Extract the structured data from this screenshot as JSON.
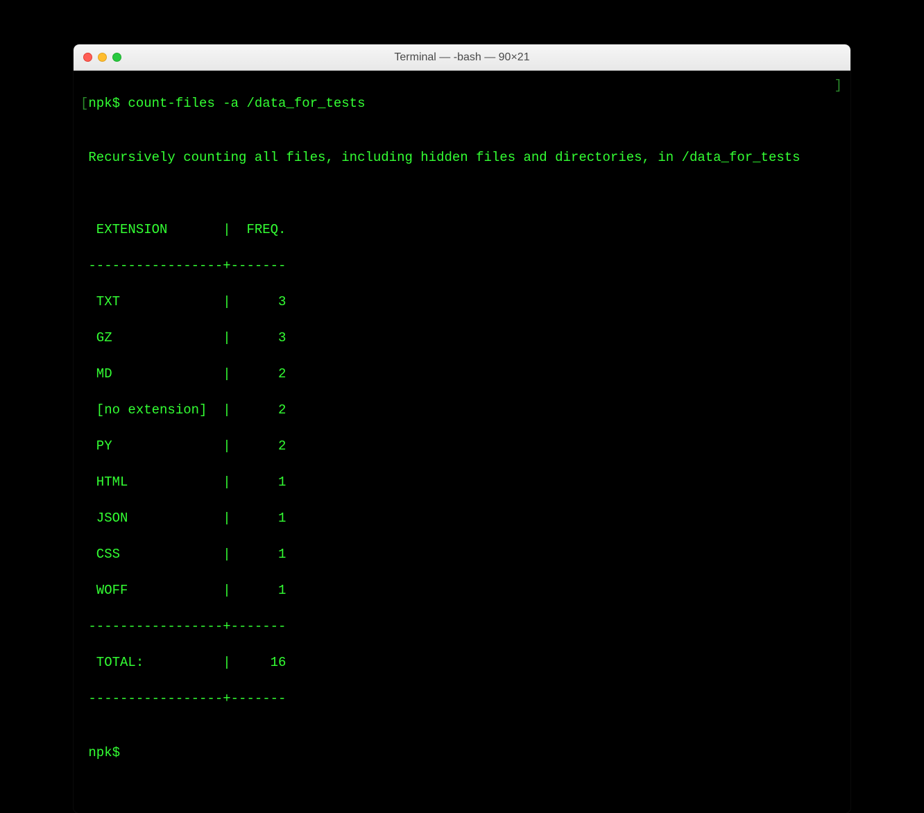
{
  "window": {
    "title": "Terminal — -bash — 90×21"
  },
  "terminal": {
    "open_bracket": "[",
    "close_bracket": "]",
    "prompt1_user": "npk$ ",
    "command": "count-files -a /data_for_tests",
    "blank1": "",
    "status_line": " Recursively counting all files, including hidden files and directories, in /data_for_tests",
    "blank2": "",
    "blank3": "",
    "table": {
      "header": "  EXTENSION       |  FREQ.",
      "divider1": " -----------------+-------",
      "rows": [
        "  TXT             |      3",
        "  GZ              |      3",
        "  MD              |      2",
        "  [no extension]  |      2",
        "  PY              |      2",
        "  HTML            |      1",
        "  JSON            |      1",
        "  CSS             |      1",
        "  WOFF            |      1"
      ],
      "divider2": " -----------------+-------",
      "total": "  TOTAL:          |     16",
      "divider3": " -----------------+-------"
    },
    "blank4": "",
    "prompt2": " npk$ "
  },
  "chart_data": {
    "type": "table",
    "title": "File extension frequency in /data_for_tests",
    "columns": [
      "EXTENSION",
      "FREQ."
    ],
    "rows": [
      {
        "extension": "TXT",
        "freq": 3
      },
      {
        "extension": "GZ",
        "freq": 3
      },
      {
        "extension": "MD",
        "freq": 2
      },
      {
        "extension": "[no extension]",
        "freq": 2
      },
      {
        "extension": "PY",
        "freq": 2
      },
      {
        "extension": "HTML",
        "freq": 1
      },
      {
        "extension": "JSON",
        "freq": 1
      },
      {
        "extension": "CSS",
        "freq": 1
      },
      {
        "extension": "WOFF",
        "freq": 1
      }
    ],
    "total": 16
  }
}
